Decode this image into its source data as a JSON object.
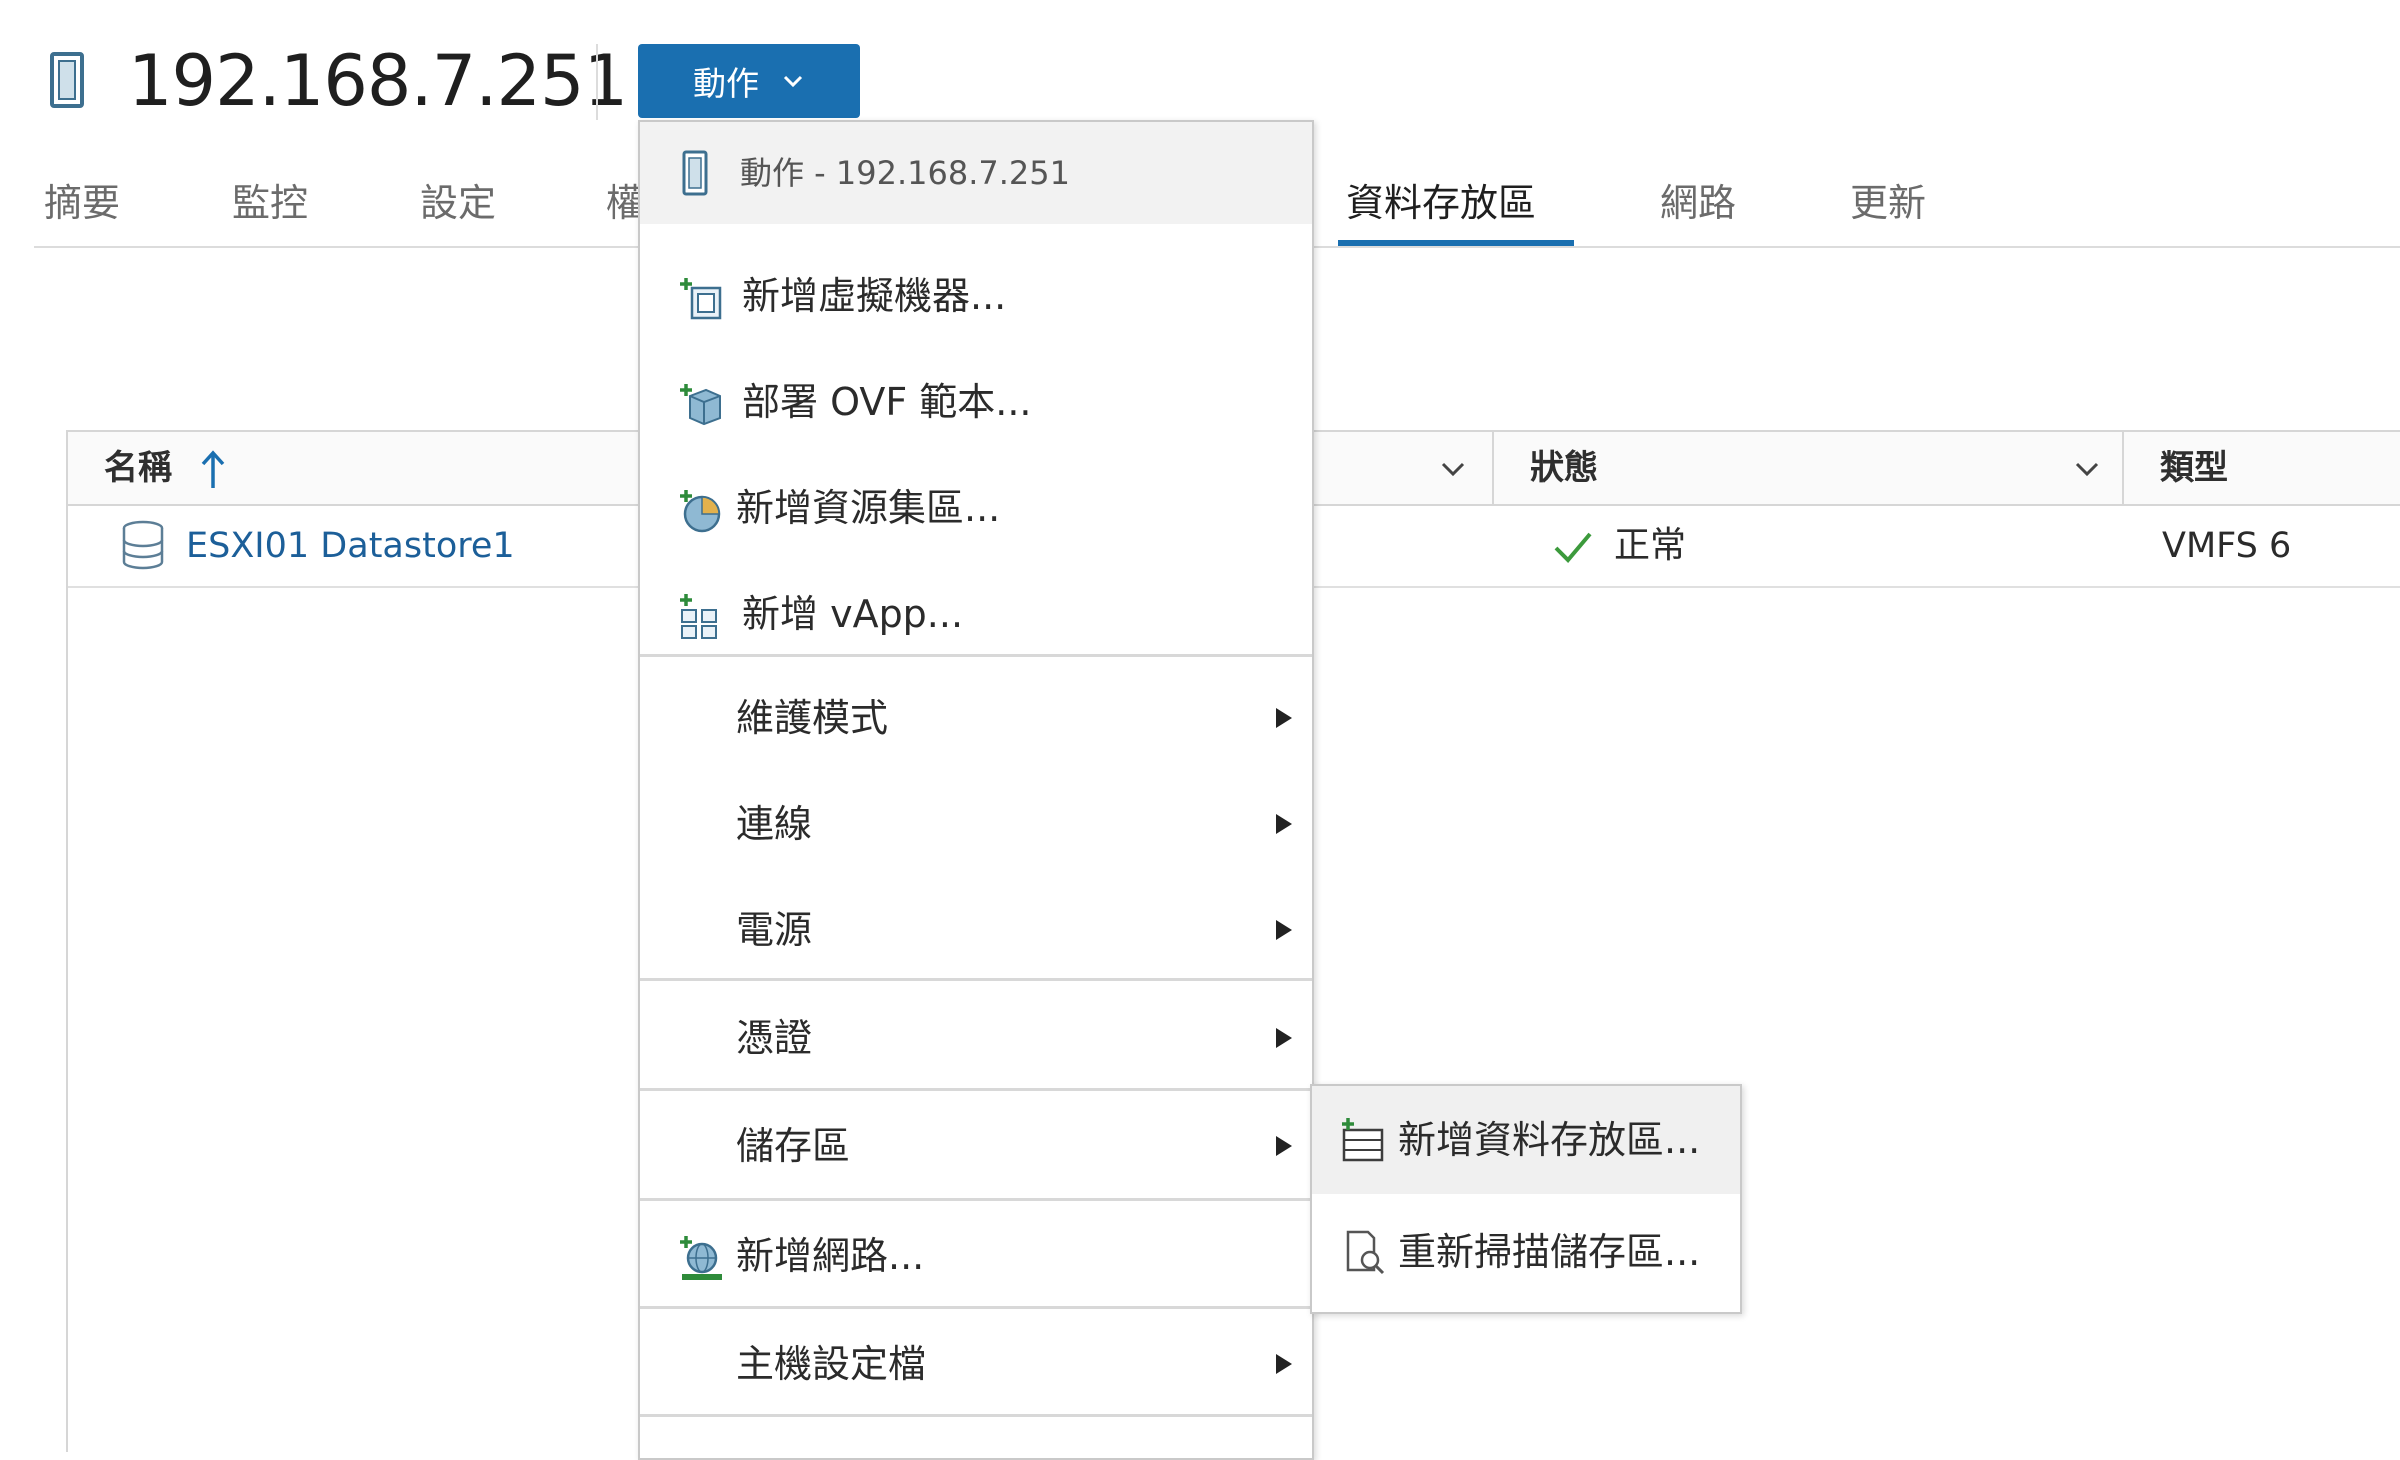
{
  "header": {
    "host_name": "192.168.7.251",
    "actions_button_label": "動作"
  },
  "tabs": [
    {
      "label": "摘要"
    },
    {
      "label": "監控"
    },
    {
      "label": "設定"
    },
    {
      "label": "權"
    },
    {
      "label": "資料存放區",
      "active": true
    },
    {
      "label": "網路"
    },
    {
      "label": "更新"
    }
  ],
  "table": {
    "columns": [
      {
        "label": "名稱"
      },
      {
        "label": "狀態"
      },
      {
        "label": "類型"
      }
    ],
    "rows": [
      {
        "name": "ESXI01 Datastore1",
        "status": "正常",
        "type": "VMFS 6"
      }
    ]
  },
  "actions_menu": {
    "header_label": "動作 - 192.168.7.251",
    "items": [
      {
        "label": "新增虛擬機器..."
      },
      {
        "label": "部署 OVF 範本..."
      },
      {
        "label": "新增資源集區..."
      },
      {
        "label": "新增 vApp..."
      },
      {
        "label": "維護模式"
      },
      {
        "label": "連線"
      },
      {
        "label": "電源"
      },
      {
        "label": "憑證"
      },
      {
        "label": "儲存區"
      },
      {
        "label": "新增網路..."
      },
      {
        "label": "主機設定檔"
      }
    ]
  },
  "storage_submenu": {
    "items": [
      {
        "label": "新增資料存放區..."
      },
      {
        "label": "重新掃描儲存區..."
      }
    ]
  },
  "colors": {
    "accent": "#1a6fb0",
    "link": "#1c5f99",
    "ok": "#3c9a3c"
  }
}
